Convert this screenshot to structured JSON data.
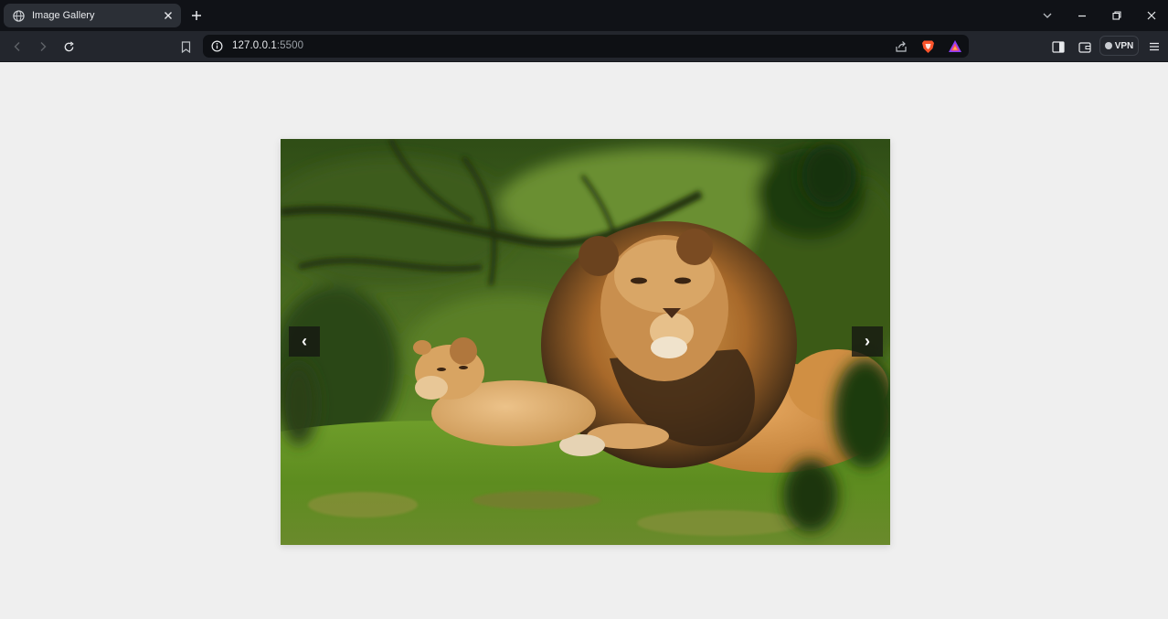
{
  "browser": {
    "tab": {
      "title": "Image Gallery",
      "favicon": "globe-icon"
    },
    "address": {
      "host": "127.0.0.1",
      "port": ":5500"
    },
    "vpn_label": "VPN",
    "colors": {
      "tabstrip": "#101217",
      "toolbar": "#23262d",
      "omnibox": "#0e1014"
    }
  },
  "page": {
    "background": "#efefef",
    "gallery": {
      "prev_label": "‹",
      "next_label": "›",
      "image_subject": "lion-and-cub-photo"
    }
  }
}
